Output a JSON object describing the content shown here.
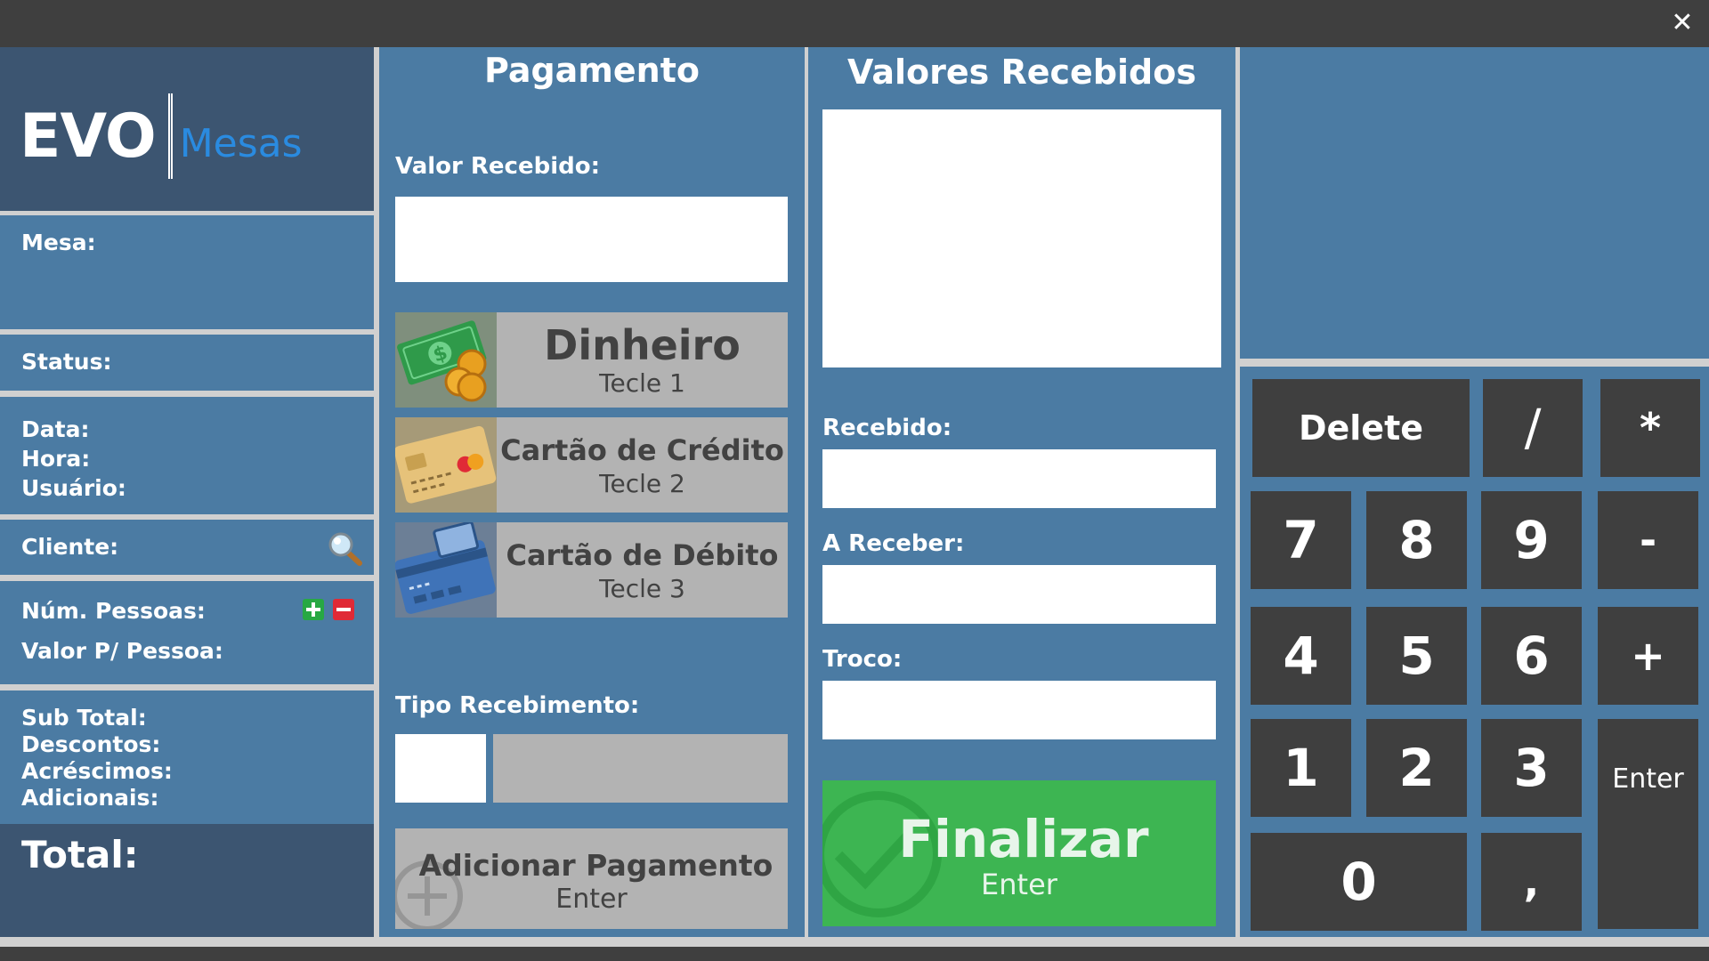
{
  "window": {
    "close_icon": "close-icon"
  },
  "logo": {
    "brand": "EVO",
    "product": "Mesas"
  },
  "info": {
    "mesa": "Mesa:",
    "status": "Status:",
    "data": "Data:",
    "hora": "Hora:",
    "usuario": "Usuário:",
    "cliente": "Cliente:",
    "num_pessoas": "Núm. Pessoas:",
    "valor_pessoa": "Valor P/ Pessoa:",
    "sub_total": "Sub Total:",
    "descontos": "Descontos:",
    "acrescimos": "Acréscimos:",
    "adicionais": "Adicionais:",
    "total": "Total:"
  },
  "payment": {
    "title": "Pagamento",
    "valor_recebido_label": "Valor Recebido:",
    "methods": [
      {
        "label": "Dinheiro",
        "hint": "Tecle 1",
        "icon": "cash-icon"
      },
      {
        "label": "Cartão de Crédito",
        "hint": "Tecle 2",
        "icon": "credit-card-icon"
      },
      {
        "label": "Cartão de Débito",
        "hint": "Tecle 3",
        "icon": "debit-card-icon"
      }
    ],
    "tipo_recebimento_label": "Tipo Recebimento:",
    "add_button": {
      "label": "Adicionar Pagamento",
      "hint": "Enter"
    }
  },
  "received": {
    "title": "Valores Recebidos",
    "recebido_label": "Recebido:",
    "a_receber_label": "A Receber:",
    "troco_label": "Troco:",
    "finalize": {
      "label": "Finalizar",
      "hint": "Enter"
    }
  },
  "keypad": {
    "delete": "Delete",
    "divide": "/",
    "multiply": "*",
    "minus": "-",
    "plus": "+",
    "enter": "Enter",
    "comma": ",",
    "digits": [
      "7",
      "8",
      "9",
      "4",
      "5",
      "6",
      "1",
      "2",
      "3",
      "0"
    ]
  },
  "colors": {
    "panel": "#4b7ba3",
    "panel_dark": "#3c5571",
    "key": "#3f3f3f",
    "finalize": "#3db552",
    "brand_accent": "#2a8be0",
    "add_person": "#27a843",
    "remove_person": "#e02a36"
  }
}
